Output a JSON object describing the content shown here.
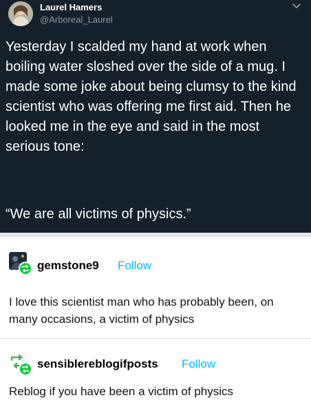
{
  "tweet": {
    "name": "Laurel Hamers",
    "handle": "@Arboreal_Laurel",
    "body": "Yesterday I scalded my hand at work when boiling water sloshed over the side of a mug. I made some joke about being clumsy to the kind scientist who was offering me first aid. Then he looked me in the eye and said in the most serious tone:",
    "quote": "“We are all victims of physics.”",
    "icons": {
      "avatar": "profile-photo",
      "menu": "chevron-down-icon"
    },
    "colors": {
      "background": "#15202b",
      "text": "#ffffff",
      "muted": "#8899a6"
    }
  },
  "posts": [
    {
      "username": "gemstone9",
      "follow_label": "Follow",
      "text": "I love this scientist man who has probably been, on many occasions, a victim of physics"
    },
    {
      "username": "sensiblereblogifposts",
      "follow_label": "Follow",
      "text": "Reblog if you have been a victim of physics"
    }
  ],
  "colors": {
    "follow": "#00b8ff",
    "reblog_badge": "#00cf35"
  }
}
